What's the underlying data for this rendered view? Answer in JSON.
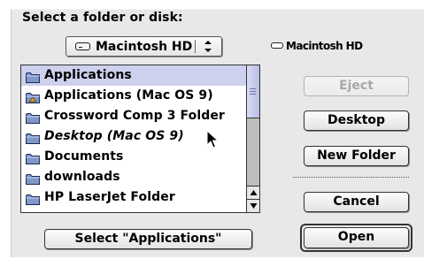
{
  "dialog": {
    "heading": "Select a folder or disk:",
    "volume_popup": {
      "label": "Macintosh HD",
      "icon": "hard-disk-icon",
      "arrows": "up-down-arrows-icon"
    },
    "volume_name": "Macintosh HD",
    "file_list": {
      "items": [
        {
          "label": "Applications",
          "icon": "folder-icon",
          "selected": true,
          "italic": false
        },
        {
          "label": "Applications (Mac OS 9)",
          "icon": "applications-folder-icon",
          "selected": false,
          "italic": false
        },
        {
          "label": "Crossword Comp 3 Folder",
          "icon": "folder-icon",
          "selected": false,
          "italic": false
        },
        {
          "label": "Desktop (Mac OS 9)",
          "icon": "folder-icon",
          "selected": false,
          "italic": true
        },
        {
          "label": "Documents",
          "icon": "folder-icon",
          "selected": false,
          "italic": false
        },
        {
          "label": "downloads",
          "icon": "folder-icon",
          "selected": false,
          "italic": false
        },
        {
          "label": "HP LaserJet Folder",
          "icon": "folder-icon",
          "selected": false,
          "italic": false
        }
      ]
    },
    "buttons": {
      "eject": "Eject",
      "desktop": "Desktop",
      "new_folder": "New Folder",
      "cancel": "Cancel",
      "open": "Open",
      "select": "Select \"Applications\""
    }
  },
  "colors": {
    "dialog_background": "#e8e8e8",
    "selection_highlight": "#cdd1ed",
    "scroll_thumb": "#c8cbf0",
    "disabled_text": "#a8a8a8"
  }
}
